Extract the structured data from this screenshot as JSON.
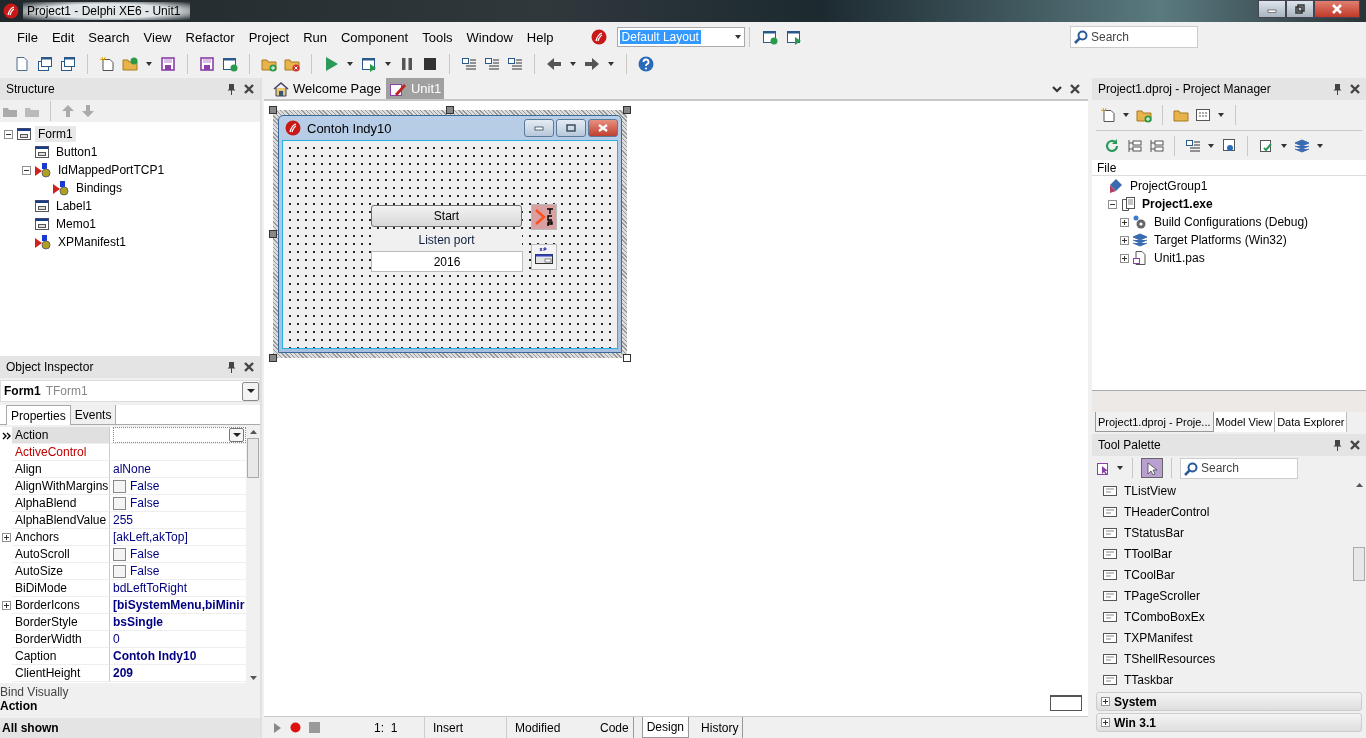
{
  "window": {
    "title": "Project1 - Delphi XE6 - Unit1"
  },
  "menu": [
    "File",
    "Edit",
    "Search",
    "View",
    "Refactor",
    "Project",
    "Run",
    "Component",
    "Tools",
    "Window",
    "Help"
  ],
  "layout_combo": {
    "value": "Default Layout"
  },
  "ide_search": {
    "placeholder": "Search"
  },
  "structure": {
    "title": "Structure",
    "tree": [
      {
        "label": "Form1",
        "kind": "form",
        "selected": true,
        "expanded": true,
        "children": [
          {
            "label": "Button1",
            "kind": "control",
            "selected": false
          },
          {
            "label": "IdMappedPortTCP1",
            "kind": "component",
            "selected": false,
            "expanded": true,
            "children": [
              {
                "label": "Bindings",
                "kind": "collection",
                "selected": false
              }
            ]
          },
          {
            "label": "Label1",
            "kind": "control",
            "selected": false
          },
          {
            "label": "Memo1",
            "kind": "control",
            "selected": false
          },
          {
            "label": "XPManifest1",
            "kind": "component",
            "selected": false
          }
        ]
      }
    ]
  },
  "object_inspector": {
    "title": "Object Inspector",
    "object_name": "Form1",
    "object_type": "TForm1",
    "tabs": [
      {
        "label": "Properties",
        "selected": true
      },
      {
        "label": "Events",
        "selected": false
      }
    ],
    "properties": [
      {
        "name": "Action",
        "kind": "dropdown",
        "selected": true
      },
      {
        "name": "ActiveControl",
        "kind": "reference",
        "selected": false
      },
      {
        "name": "Align",
        "value": "alNone",
        "kind": "text",
        "selected": false
      },
      {
        "name": "AlignWithMargins",
        "value": "False",
        "kind": "check",
        "checked": false,
        "selected": false
      },
      {
        "name": "AlphaBlend",
        "value": "False",
        "kind": "check",
        "checked": false,
        "selected": false
      },
      {
        "name": "AlphaBlendValue",
        "value": "255",
        "kind": "text",
        "selected": false
      },
      {
        "name": "Anchors",
        "value": "[akLeft,akTop]",
        "kind": "text",
        "expanded": false,
        "selected": false
      },
      {
        "name": "AutoScroll",
        "value": "False",
        "kind": "check",
        "checked": false,
        "selected": false
      },
      {
        "name": "AutoSize",
        "value": "False",
        "kind": "check",
        "checked": false,
        "selected": false
      },
      {
        "name": "BiDiMode",
        "value": "bdLeftToRight",
        "kind": "text",
        "selected": false
      },
      {
        "name": "BorderIcons",
        "value": "[biSystemMenu,biMinir",
        "kind": "bold",
        "expanded": false,
        "selected": false
      },
      {
        "name": "BorderStyle",
        "value": "bsSingle",
        "kind": "bold",
        "selected": false
      },
      {
        "name": "BorderWidth",
        "value": "0",
        "kind": "text",
        "selected": false
      },
      {
        "name": "Caption",
        "value": "Contoh Indy10",
        "kind": "bold",
        "selected": false
      },
      {
        "name": "ClientHeight",
        "value": "209",
        "kind": "bold",
        "selected": false
      }
    ],
    "link": "Bind Visually",
    "description_title": "Action",
    "status": "All shown"
  },
  "editor": {
    "tabs": [
      {
        "label": "Welcome Page",
        "kind": "welcome",
        "selected": false
      },
      {
        "label": "Unit1",
        "kind": "unit",
        "selected": true
      }
    ],
    "form": {
      "caption": "Contoh Indy10",
      "button": "Start",
      "label": "Listen port",
      "edit_value": "2016"
    }
  },
  "status_bar": {
    "position": "1:  1",
    "mode": "Insert",
    "state": "Modified",
    "tabs": [
      {
        "label": "Code",
        "selected": false
      },
      {
        "label": "Design",
        "selected": true
      },
      {
        "label": "History",
        "selected": false
      }
    ]
  },
  "project_manager": {
    "title": "Project1.dproj - Project Manager",
    "column": "File",
    "tree": [
      {
        "label": "ProjectGroup1",
        "kind": "group",
        "active": false,
        "children": [
          {
            "label": "Project1.exe",
            "kind": "project",
            "active": true,
            "expanded": true,
            "children": [
              {
                "label": "Build Configurations (Debug)",
                "kind": "config",
                "active": false,
                "expanded": false
              },
              {
                "label": "Target Platforms (Win32)",
                "kind": "platforms",
                "active": false,
                "expanded": false
              },
              {
                "label": "Unit1.pas",
                "kind": "file",
                "active": false,
                "expanded": false
              }
            ]
          }
        ]
      }
    ],
    "tabs": [
      {
        "label": "Project1.dproj - Proje...",
        "selected": true
      },
      {
        "label": "Model View",
        "selected": false
      },
      {
        "label": "Data Explorer",
        "selected": false
      }
    ]
  },
  "tool_palette": {
    "title": "Tool Palette",
    "search": {
      "placeholder": "Search"
    },
    "items": [
      "TListView",
      "THeaderControl",
      "TStatusBar",
      "TToolBar",
      "TCoolBar",
      "TPageScroller",
      "TComboBoxEx",
      "TXPManifest",
      "TShellResources",
      "TTaskbar"
    ],
    "categories": [
      {
        "label": "System",
        "expanded": false
      },
      {
        "label": "Win 3.1",
        "expanded": false
      }
    ]
  }
}
